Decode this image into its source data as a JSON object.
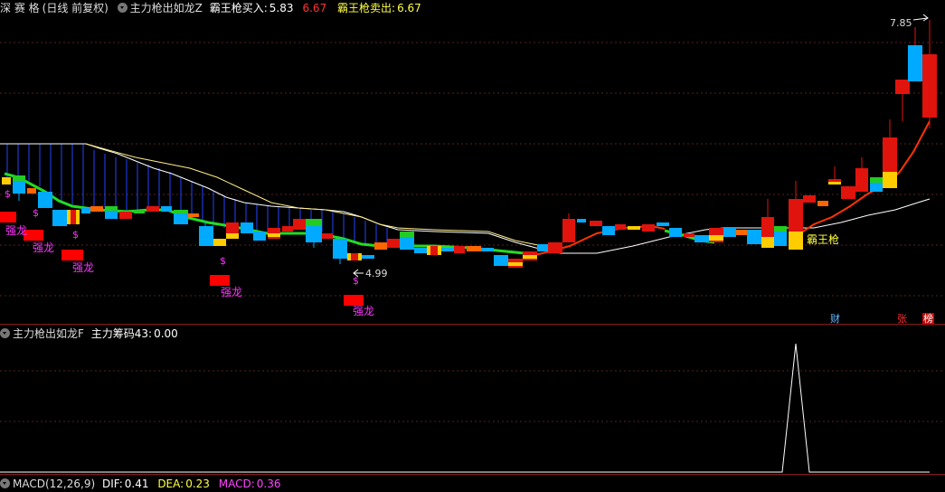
{
  "main_header": {
    "stock_name": "深 赛 格",
    "period": "(日线 前复权)",
    "indicator": "主力枪出如龙Z",
    "buy_label": "霸王枪买入:",
    "buy_value": "5.83",
    "buy_value2": "6.67",
    "sell_label": "霸王枪卖出:",
    "sell_value": "6.67"
  },
  "sub_header": {
    "indicator": "主力枪出如龙F",
    "chip_label": "主力筹码43:",
    "chip_value": "0.00"
  },
  "macd_header": {
    "name": "MACD(12,26,9)",
    "dif_label": "DIF:",
    "dif_value": "0.41",
    "dea_label": "DEA:",
    "dea_value": "0.23",
    "macd_label": "MACD:",
    "macd_value": "0.36"
  },
  "annotations": {
    "high_price": "7.85",
    "low_price": "4.99",
    "signal_label": "霸王枪",
    "strong_dragon": "强龙",
    "dollar": "$"
  },
  "badges": {
    "finance": "财",
    "limit_up": "张",
    "ranking": "榜"
  },
  "colors": {
    "background": "#000000",
    "up_candle": "#e0140c",
    "down_candle": "#00aaff",
    "trend_line": "#22dd22",
    "signal_line": "#ff3300",
    "strong_dragon_text": "#ff33ff",
    "header_yellow": "#ffff44",
    "header_red": "#ff3333"
  }
}
